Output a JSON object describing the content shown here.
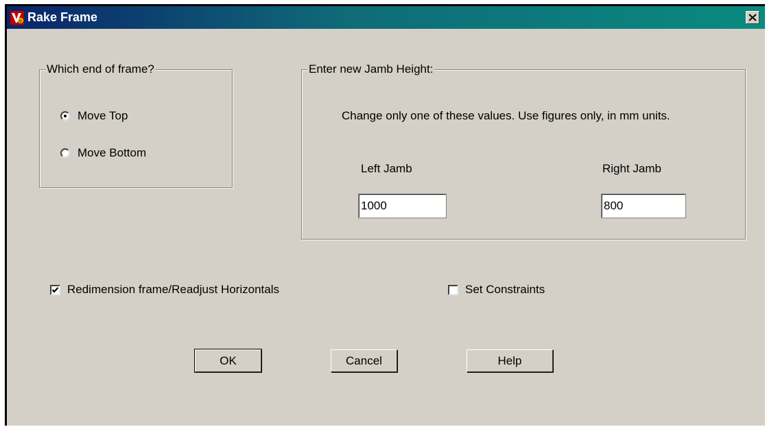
{
  "window": {
    "title": "Rake Frame",
    "app_icon": "v6-app-icon",
    "close_icon": "close-icon"
  },
  "frame_end_group": {
    "legend": "Which end of frame?",
    "options": [
      {
        "label": "Move Top",
        "selected": true
      },
      {
        "label": "Move Bottom",
        "selected": false
      }
    ]
  },
  "jamb_group": {
    "legend": "Enter new Jamb Height:",
    "instruction": "Change only one of these values. Use figures only, in mm units.",
    "left_label": "Left Jamb",
    "left_value": "1000",
    "right_label": "Right Jamb",
    "right_value": "800"
  },
  "options": {
    "redimension_label": "Redimension frame/Readjust Horizontals",
    "redimension_checked": true,
    "constraints_label": "Set Constraints",
    "constraints_checked": false
  },
  "buttons": {
    "ok": "OK",
    "cancel": "Cancel",
    "help": "Help"
  },
  "colors": {
    "titlebar_start": "#0a246a",
    "titlebar_end": "#0a8a80",
    "dialog_face": "#d4d0c8"
  }
}
